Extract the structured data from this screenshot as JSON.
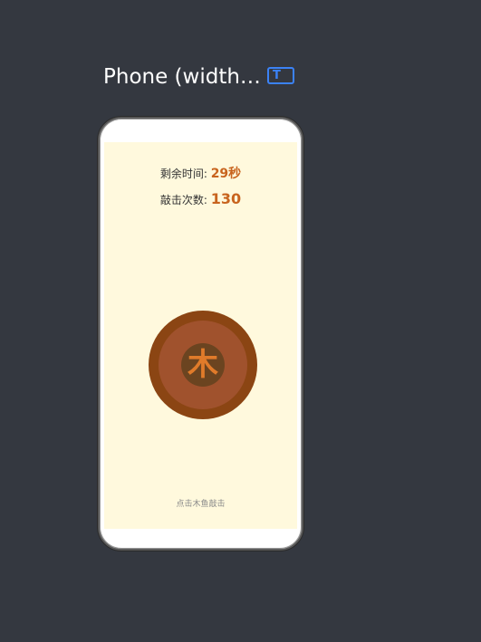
{
  "header": {
    "device_label": "Phone (width…",
    "mode_icon_glyph": "T"
  },
  "game": {
    "time_label": "剩余时间: ",
    "time_value": "29秒",
    "hits_label": "敲击次数: ",
    "hits_value": "130",
    "fish_glyph": "木",
    "hint": "点击木鱼敲击"
  },
  "colors": {
    "background": "#343840",
    "screen": "#fff9dd",
    "accent": "#c8641e",
    "fish_outer": "#8b4513",
    "fish_mid": "#a0522d",
    "fish_inner": "#6b4420"
  }
}
